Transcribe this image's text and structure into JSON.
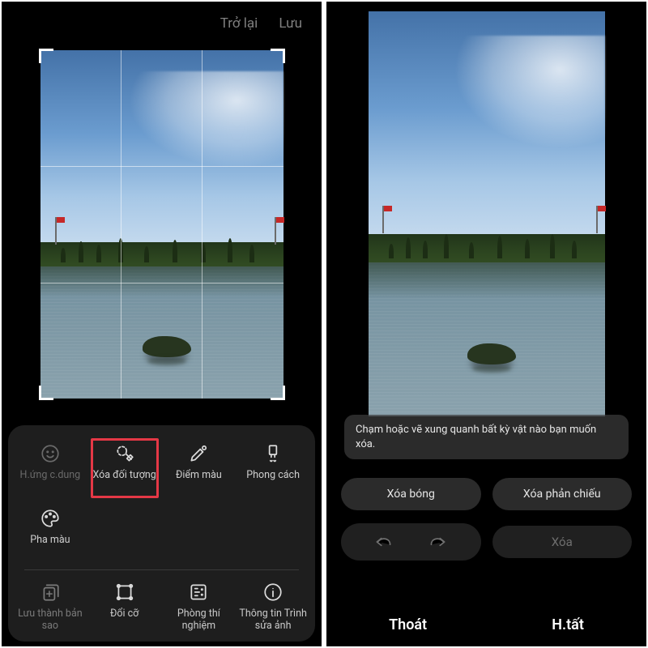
{
  "left": {
    "top": {
      "back": "Trở lại",
      "save": "Lưu"
    },
    "tools": [
      {
        "key": "portrait",
        "label": "H.ứng c.dung",
        "dim": true
      },
      {
        "key": "erase",
        "label": "Xóa đối tượng",
        "highlight": true
      },
      {
        "key": "spot",
        "label": "Điểm màu"
      },
      {
        "key": "style",
        "label": "Phong cách"
      },
      {
        "key": "mix",
        "label": "Pha màu"
      }
    ],
    "utils": [
      {
        "key": "copy",
        "label": "Lưu thành bản sao",
        "dim": true
      },
      {
        "key": "resize",
        "label": "Đổi cỡ"
      },
      {
        "key": "labs",
        "label": "Phòng thí nghiệm"
      },
      {
        "key": "info",
        "label": "Thông tin Trình sửa ảnh"
      }
    ]
  },
  "right": {
    "hint": "Chạm hoặc vẽ xung quanh bất kỳ vật nào bạn muốn xóa.",
    "pills": {
      "shadow": "Xóa bóng",
      "reflection": "Xóa phản chiếu"
    },
    "delete": "Xóa",
    "bottom": {
      "exit": "Thoát",
      "done": "H.tất"
    }
  }
}
